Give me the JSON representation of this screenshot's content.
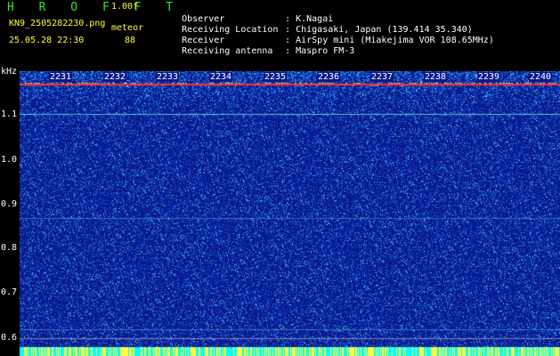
{
  "header": {
    "app_title": "H R O F F T",
    "version": "1.00f",
    "filename": "KN9_2505282230.png",
    "meteor_label": "meteor",
    "timestamp": "25.05.28 22:30",
    "meteor_count": "88"
  },
  "info": [
    {
      "label": "Observer",
      "sep": ":",
      "value": "K.Nagai"
    },
    {
      "label": "Receiving Location",
      "sep": ":",
      "value": "Chigasaki, Japan (139.414 35.340)"
    },
    {
      "label": "Receiver",
      "sep": ":",
      "value": "AirSpy mini (Miakejima VOR 108.65MHz)"
    },
    {
      "label": "Receiving antenna",
      "sep": ":",
      "value": "Maspro FM-3"
    }
  ],
  "spectrogram": {
    "unit_label": "kHz",
    "y_ticks": [
      "1.1",
      "1.0",
      "0.9",
      "0.8",
      "0.7",
      "0.6"
    ],
    "minute_labels": [
      "2231",
      "2232",
      "2233",
      "2234",
      "2235",
      "2236",
      "2237",
      "2238",
      "2239",
      "2240"
    ],
    "colors": {
      "background": "#0b1f9c",
      "noise": "#1b6ee8",
      "speckle": "#48c8e0",
      "carrier": "#ff3030",
      "timing": "#00ffff"
    }
  }
}
